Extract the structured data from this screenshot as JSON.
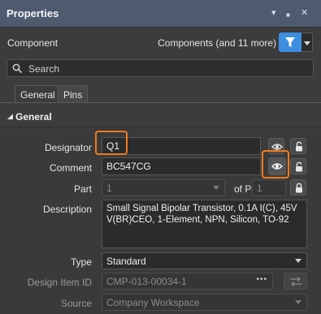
{
  "window": {
    "title": "Properties",
    "buttons": [
      "▾",
      "■",
      "✕"
    ]
  },
  "component": {
    "label": "Component",
    "value": "Components (and 11 more)"
  },
  "search": {
    "placeholder": "Search"
  },
  "tabs": [
    {
      "label": "General",
      "active": true
    },
    {
      "label": "Pins",
      "active": false
    }
  ],
  "section": {
    "label": "General",
    "arrow": "◢"
  },
  "fields": {
    "designator": {
      "label": "Designator",
      "value": "Q1"
    },
    "comment": {
      "label": "Comment",
      "value": "BC547CG"
    },
    "part": {
      "label": "Part",
      "value": "1",
      "of_label": "of Parts",
      "of_value": "1"
    },
    "description": {
      "label": "Description",
      "value": "Small Signal Bipolar Transistor, 0.1A I(C), 45V V(BR)CEO, 1-Element, NPN, Silicon, TO-92"
    },
    "type": {
      "label": "Type",
      "value": "Standard"
    },
    "design_item_id": {
      "label": "Design Item ID",
      "value": "CMP-013-00034-1",
      "button": "•••"
    },
    "source": {
      "label": "Source",
      "value": "Company Workspace"
    }
  },
  "colors": {
    "accent": "#3d8de0",
    "highlight": "#f07a1e",
    "titlebar": "#4e5a6e"
  }
}
